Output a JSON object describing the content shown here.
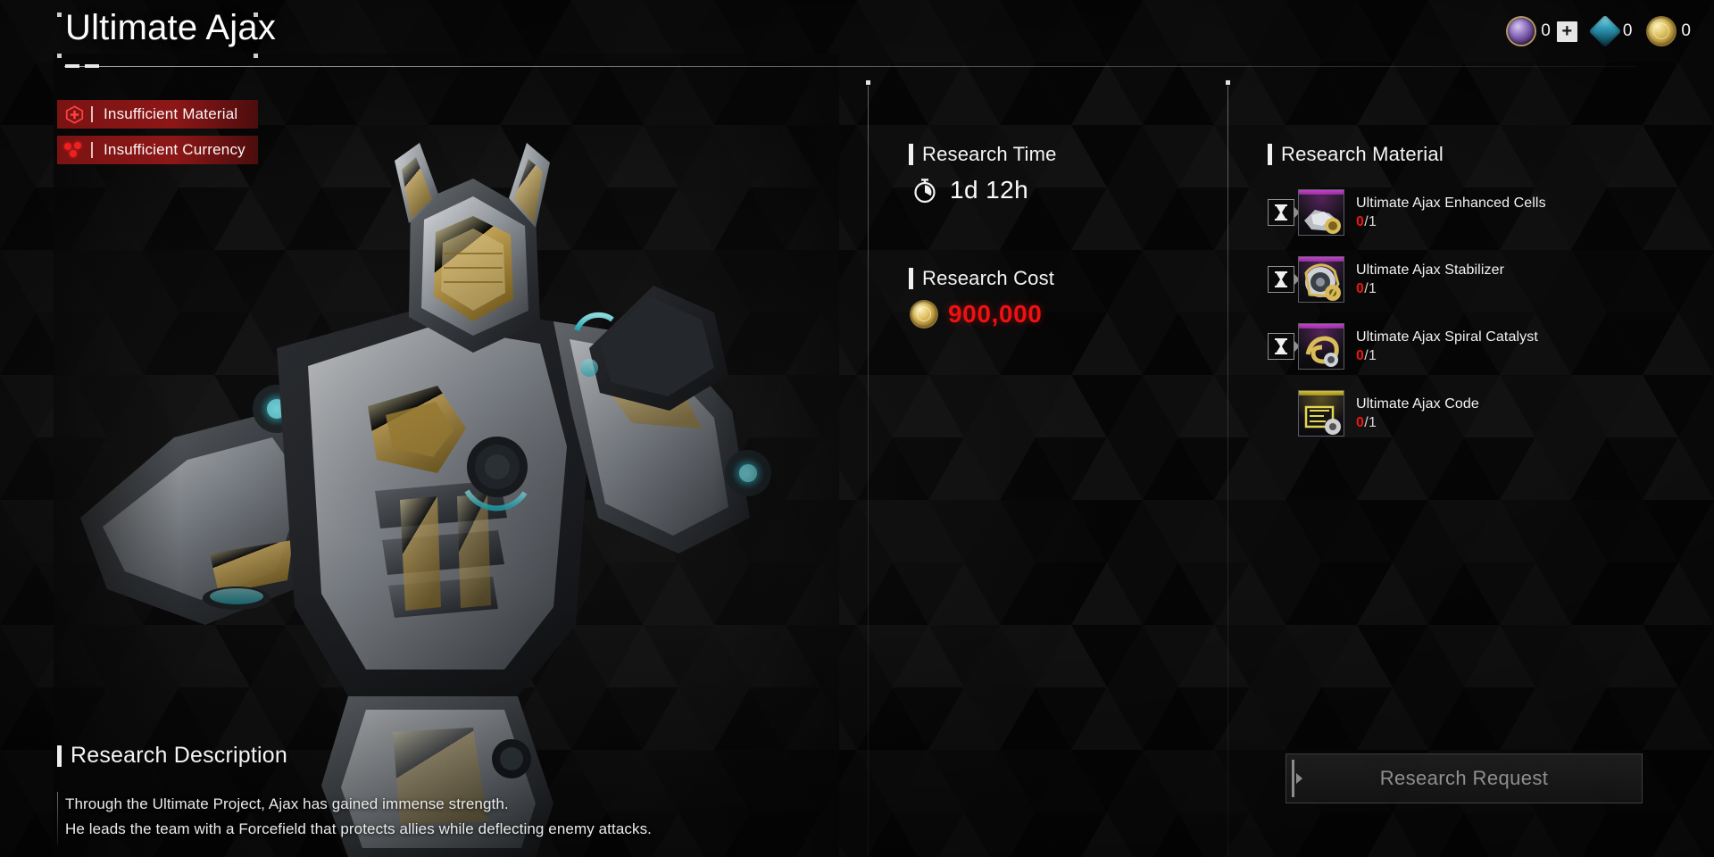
{
  "header": {
    "title": "Ultimate Ajax"
  },
  "currencies": [
    {
      "id": "caliber",
      "icon": "purple-orb-icon",
      "value": "0",
      "has_plus": true,
      "plus_label": "+"
    },
    {
      "id": "crystal",
      "icon": "blue-gem-icon",
      "value": "0",
      "has_plus": false,
      "plus_label": ""
    },
    {
      "id": "gold",
      "icon": "gold-coin-icon",
      "value": "0",
      "has_plus": false,
      "plus_label": ""
    }
  ],
  "warnings": [
    {
      "icon": "hex-plus-icon",
      "label": "Insufficient Material",
      "color": "#8d1717"
    },
    {
      "icon": "red-dots-icon",
      "label": "Insufficient Currency",
      "color": "#8d1717"
    }
  ],
  "research_time": {
    "heading": "Research Time",
    "icon": "stopwatch-icon",
    "value": "1d 12h"
  },
  "research_cost": {
    "heading": "Research Cost",
    "icon": "gold-coin-icon",
    "value": "900,000",
    "color": "#ee1111"
  },
  "research_material": {
    "heading": "Research Material",
    "items": [
      {
        "name": "Ultimate Ajax Enhanced Cells",
        "have": "0",
        "separator": "/",
        "need": "1",
        "rarity_color": "#c83fd0",
        "timer": true,
        "timer_icon": "hourglass-icon"
      },
      {
        "name": "Ultimate Ajax Stabilizer",
        "have": "0",
        "separator": "/",
        "need": "1",
        "rarity_color": "#c83fd0",
        "timer": true,
        "timer_icon": "hourglass-icon"
      },
      {
        "name": "Ultimate Ajax Spiral Catalyst",
        "have": "0",
        "separator": "/",
        "need": "1",
        "rarity_color": "#c83fd0",
        "timer": true,
        "timer_icon": "hourglass-icon"
      },
      {
        "name": "Ultimate Ajax Code",
        "have": "0",
        "separator": "/",
        "need": "1",
        "rarity_color": "#d9c22c",
        "timer": false,
        "timer_icon": ""
      }
    ]
  },
  "research_request": {
    "label": "Research Request",
    "enabled": false
  },
  "description": {
    "heading": "Research Description",
    "lines": [
      "Through the Ultimate Project, Ajax has gained immense strength.",
      "He leads the team with a Forcefield that protects allies while deflecting enemy attacks."
    ]
  }
}
